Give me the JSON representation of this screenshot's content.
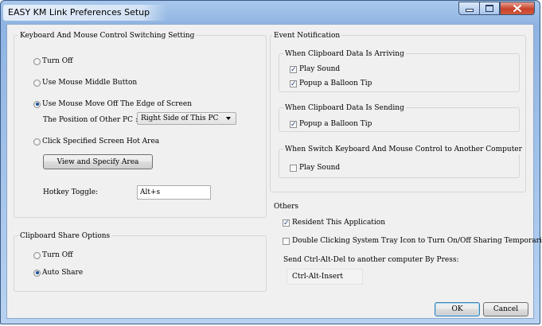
{
  "window": {
    "title": "EASY KM Link Preferences Setup"
  },
  "keyboard_mouse": {
    "group_label": "Keyboard And Mouse Control Switching Setting",
    "options": [
      {
        "label": "Turn Off",
        "selected": false
      },
      {
        "label": "Use Mouse Middle Button",
        "selected": false
      },
      {
        "label": "Use Mouse Move Off The Edge of Screen",
        "selected": true
      },
      {
        "label": "Click Specified Screen Hot Area",
        "selected": false
      }
    ],
    "position_label": "The Position of Other PC :",
    "position_value": "Right Side of This PC",
    "view_button": "View and Specify Area",
    "hotkey_label": "Hotkey Toggle:",
    "hotkey_value": "Alt+s"
  },
  "clipboard": {
    "group_label": "Clipboard Share Options",
    "options": [
      {
        "label": "Turn Off",
        "selected": false
      },
      {
        "label": "Auto Share",
        "selected": true
      }
    ]
  },
  "event_notification": {
    "group_label": "Event Notification",
    "arriving": {
      "label": "When Clipboard Data Is Arriving",
      "play_sound": {
        "label": "Play Sound",
        "checked": true
      },
      "balloon": {
        "label": "Popup a Balloon Tip",
        "checked": true
      }
    },
    "sending": {
      "label": "When Clipboard Data Is Sending",
      "balloon": {
        "label": "Popup a Balloon Tip",
        "checked": true
      }
    },
    "switch": {
      "label": "When Switch Keyboard And Mouse Control to Another Computer",
      "play_sound": {
        "label": "Play Sound",
        "checked": false
      }
    }
  },
  "others": {
    "group_label": "Others",
    "resident": {
      "label": "Resident This Application",
      "checked": true
    },
    "double_click": {
      "label": "Double Clicking System Tray Icon to Turn On/Off Sharing Temporarily",
      "checked": false
    },
    "ctrl_alt_del_label": "Send Ctrl-Alt-Del to another computer By Press:",
    "ctrl_alt_del_value": "Ctrl-Alt-Insert"
  },
  "buttons": {
    "ok": "OK",
    "cancel": "Cancel"
  },
  "colors": {
    "title_bar": "#8fb4e2",
    "close_button": "#c7422b",
    "dialog_bg": "#f0f0f0"
  }
}
